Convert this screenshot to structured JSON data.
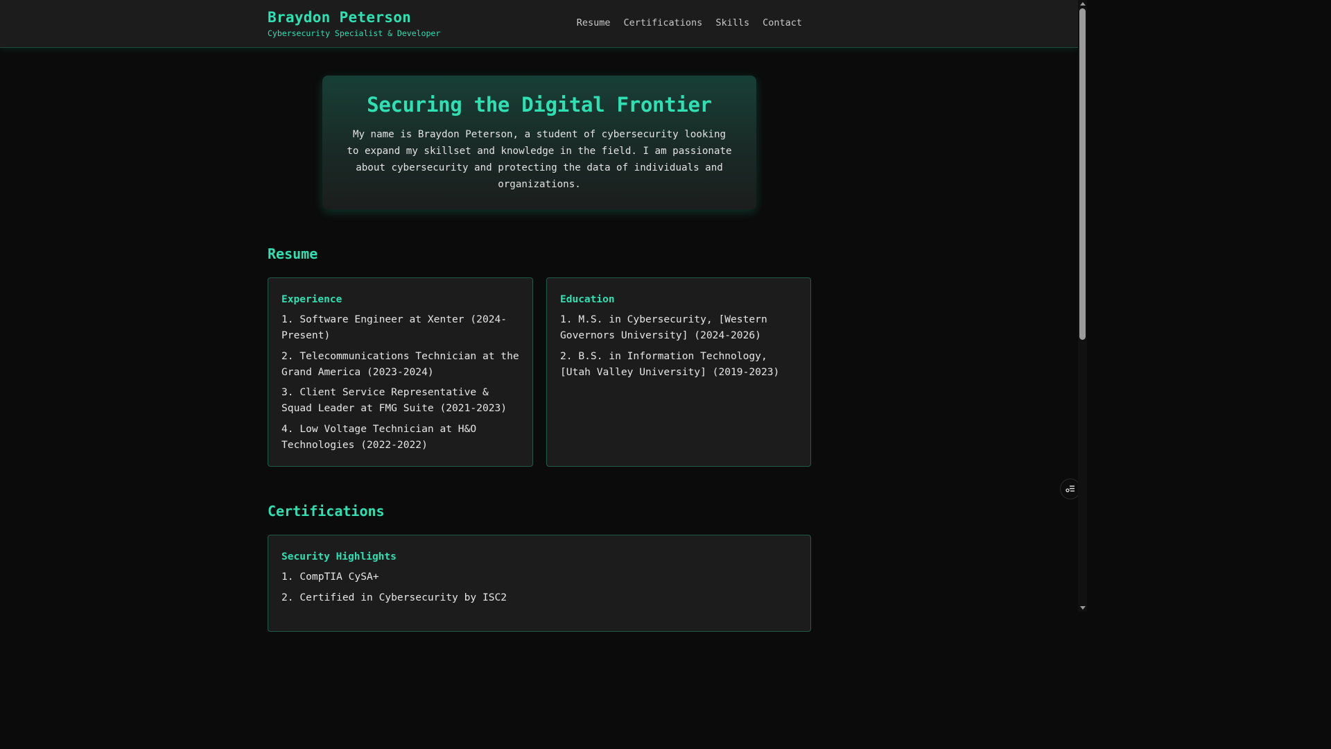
{
  "header": {
    "name": "Braydon Peterson",
    "tagline": "Cybersecurity Specialist & Developer",
    "nav": [
      "Resume",
      "Certifications",
      "Skills",
      "Contact"
    ]
  },
  "hero": {
    "title": "Securing the Digital Frontier",
    "text": "My name is Braydon Peterson, a student of cybersecurity looking to expand my skillset and knowledge in the field. I am passionate about cybersecurity and protecting the data of individuals and organizations."
  },
  "resume": {
    "title": "Resume",
    "experience": {
      "heading": "Experience",
      "items": [
        "1. Software Engineer at Xenter (2024-Present)",
        "2. Telecommunications Technician at the Grand America (2023-2024)",
        "3. Client Service Representative & Squad Leader at FMG Suite (2021-2023)",
        "4. Low Voltage Technician at H&O Technologies (2022-2022)"
      ]
    },
    "education": {
      "heading": "Education",
      "items": [
        "1. M.S. in Cybersecurity, [Western Governors University] (2024-2026)",
        "2. B.S. in Information Technology, [Utah Valley University] (2019-2023)"
      ]
    }
  },
  "certifications": {
    "title": "Certifications",
    "card": {
      "heading": "Security Highlights",
      "items": [
        "1. CompTIA CySA+",
        "2. Certified in Cybersecurity by ISC2"
      ]
    }
  },
  "floating_button": {
    "icon": "settings-list-icon"
  },
  "colors": {
    "accent": "#2ee0b2",
    "background": "#0b0b0b",
    "card": "#1c1c1c",
    "border": "#1f5a4a"
  }
}
